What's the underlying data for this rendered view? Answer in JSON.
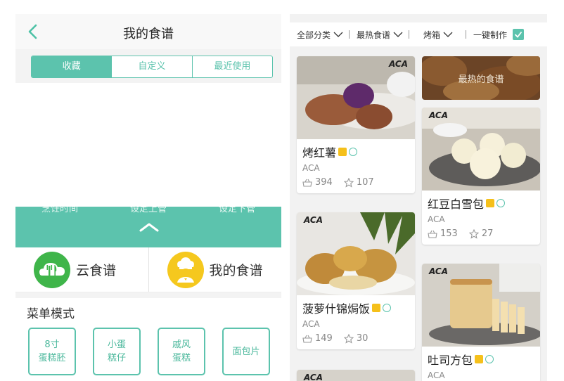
{
  "left": {
    "nav_title": "我的食谱",
    "tabs": [
      "收藏",
      "自定义",
      "最近使用"
    ],
    "drawer_items": [
      "烹饪时间",
      "设定上管",
      "设定下管"
    ],
    "modes": [
      {
        "label": "云食谱",
        "icon": "cloud-fork-knife-icon",
        "color": "#3fb54a"
      },
      {
        "label": "我的食谱",
        "icon": "chef-icon",
        "color": "#f5c81e"
      }
    ],
    "menu_title": "菜单模式",
    "menu_buttons": [
      "8寸\n蛋糕胚",
      "小蛋\n糕仔",
      "戚风\n蛋糕",
      "面包片"
    ]
  },
  "right": {
    "filters": [
      "全部分类",
      "最热食谱",
      "烤箱",
      "一键制作"
    ],
    "hot_banner": "最热的食谱",
    "recipes": [
      {
        "name": "烤红薯",
        "brand": "ACA",
        "count": "394",
        "stars": "107",
        "aca": "ACA"
      },
      {
        "name": "红豆白雪包",
        "brand": "ACA",
        "count": "153",
        "stars": "27",
        "aca": "ACA"
      },
      {
        "name": "菠萝什锦焗饭",
        "brand": "ACA",
        "count": "149",
        "stars": "30",
        "aca": "ACA"
      },
      {
        "name": "吐司方包",
        "brand": "ACA",
        "count": "",
        "stars": "",
        "aca": "ACA"
      }
    ],
    "next_aca": "ACA"
  },
  "colors": {
    "accent": "#5cc3ad",
    "cloud_green": "#3fb54a",
    "chef_yellow": "#f5c81e"
  }
}
